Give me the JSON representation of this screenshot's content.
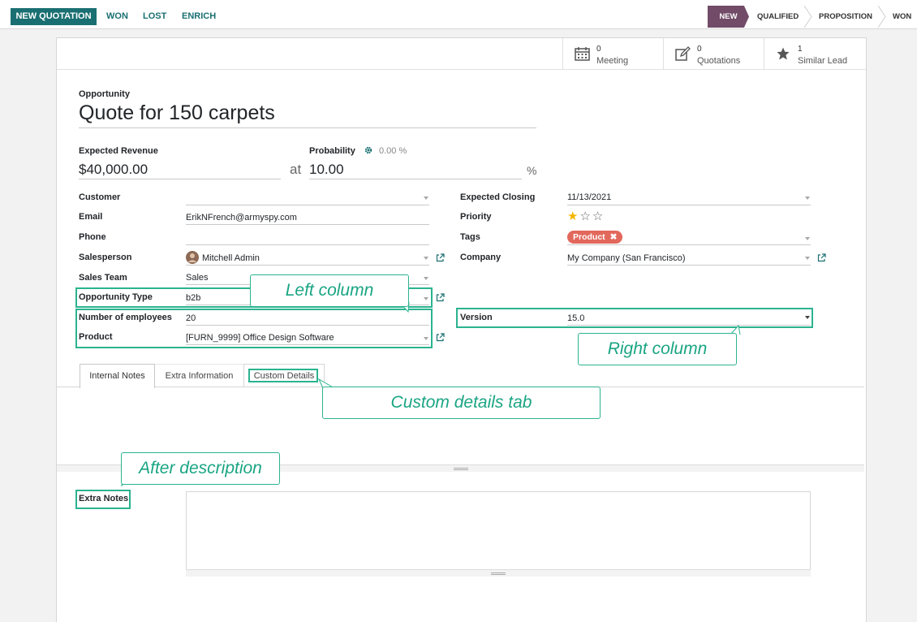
{
  "actions": {
    "new_quotation": "NEW QUOTATION",
    "won": "WON",
    "lost": "LOST",
    "enrich": "ENRICH"
  },
  "stages": [
    "NEW",
    "QUALIFIED",
    "PROPOSITION",
    "WON"
  ],
  "smart_buttons": [
    {
      "count": "0",
      "label": "Meeting",
      "icon": "calendar-icon"
    },
    {
      "count": "0",
      "label": "Quotations",
      "icon": "edit-icon"
    },
    {
      "count": "1",
      "label": "Similar Lead",
      "icon": "star-icon"
    }
  ],
  "form": {
    "type_label": "Opportunity",
    "title": "Quote for 150 carpets",
    "expected_revenue_label": "Expected Revenue",
    "expected_revenue": "$40,000.00",
    "at": "at",
    "probability_label": "Probability",
    "probability_auto": "0.00 %",
    "probability": "10.00",
    "percent": "%",
    "left": {
      "customer_label": "Customer",
      "customer": "",
      "email_label": "Email",
      "email": "ErikNFrench@armyspy.com",
      "phone_label": "Phone",
      "phone": "",
      "salesperson_label": "Salesperson",
      "salesperson": "Mitchell Admin",
      "sales_team_label": "Sales Team",
      "sales_team": "Sales",
      "opportunity_type_label": "Opportunity Type",
      "opportunity_type": "b2b",
      "employees_label": "Number of employees",
      "employees": "20",
      "product_label": "Product",
      "product": "[FURN_9999] Office Design Software"
    },
    "right": {
      "closing_label": "Expected Closing",
      "closing": "11/13/2021",
      "priority_label": "Priority",
      "priority_stars": 1,
      "priority_max": 3,
      "tags_label": "Tags",
      "tag": "Product",
      "company_label": "Company",
      "company": "My Company (San Francisco)",
      "version_label": "Version",
      "version": "15.0"
    },
    "tabs": [
      "Internal Notes",
      "Extra Information",
      "Custom Details"
    ],
    "extra_notes_label": "Extra Notes"
  },
  "annotations": {
    "left_column": "Left column",
    "right_column": "Right column",
    "custom_tab": "Custom details tab",
    "after_description": "After description"
  },
  "colors": {
    "primary": "#1a6f72",
    "stage_active": "#714b67",
    "annotation": "#2bb38f",
    "tag": "#e2685c",
    "star": "#f3b700"
  }
}
